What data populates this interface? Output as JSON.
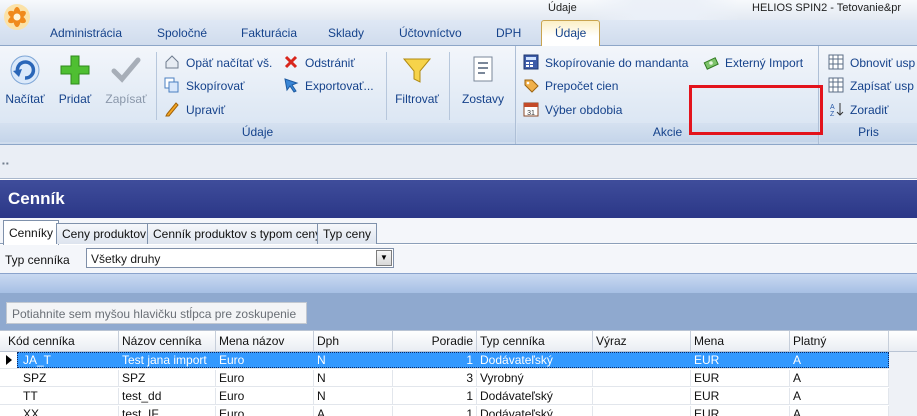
{
  "window": {
    "context_title": "Údaje",
    "title": "HELIOS SPIN2 - Tetovanie&pr"
  },
  "ribbon_tabs": [
    {
      "label": "Administrácia"
    },
    {
      "label": "Spoločné"
    },
    {
      "label": "Fakturácia"
    },
    {
      "label": "Sklady"
    },
    {
      "label": "Účtovníctvo"
    },
    {
      "label": "DPH"
    },
    {
      "label": "Údaje"
    }
  ],
  "ribbon": {
    "udaje_group": {
      "label": "Údaje",
      "load": "Načítať",
      "add": "Pridať",
      "save": "Zapísať",
      "reload_all": "Opäť načítať vš.",
      "copy": "Skopírovať",
      "edit": "Upraviť",
      "delete": "Odstrániť",
      "export": "Exportovať...",
      "filter": "Filtrovať",
      "reports": "Zostavy"
    },
    "akcie_group": {
      "label": "Akcie",
      "copy_to_tenant": "Skopírovanie do mandanta",
      "recalc_prices": "Prepočet cien",
      "select_period": "Výber obdobia",
      "external_import": "Externý Import"
    },
    "third_group": {
      "label": "Pris",
      "refresh": "Obnoviť usp",
      "save_layout": "Zapísať usp",
      "sort": "Zoradiť"
    }
  },
  "form": {
    "title": "Cenník",
    "tabs": [
      {
        "label": "Cenníky"
      },
      {
        "label": "Ceny produktov"
      },
      {
        "label": "Cenník produktov s typom ceny"
      },
      {
        "label": "Typ ceny"
      }
    ],
    "filter_label": "Typ cenníka",
    "filter_value": "Všetky druhy",
    "group_hint": "Potiahnite sem myšou hlavičku stĺpca pre zoskupenie"
  },
  "grid": {
    "columns": [
      "Kód cenníka",
      "Názov cenníka",
      "Mena názov",
      "Dph",
      "Poradie",
      "Typ cenníka",
      "Výraz",
      "Mena",
      "Platný"
    ],
    "rows": [
      [
        "JA_T",
        "Test jana import",
        "Euro",
        "N",
        "1",
        "Dodávateľský",
        "",
        "EUR",
        "A"
      ],
      [
        "SPZ",
        "SPZ",
        "Euro",
        "N",
        "3",
        "Vyrobný",
        "",
        "EUR",
        "A"
      ],
      [
        "TT",
        "test_dd",
        "Euro",
        "N",
        "1",
        "Dodávateľský",
        "",
        "EUR",
        "A"
      ],
      [
        "XX",
        "test_IF",
        "Euro",
        "A",
        "1",
        "Dodávateľský",
        "",
        "EUR",
        "A"
      ]
    ]
  }
}
